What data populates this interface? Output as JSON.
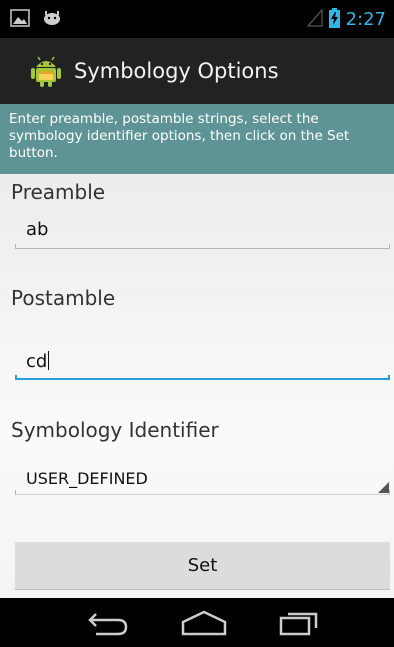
{
  "status_bar": {
    "time": "2:27",
    "icons": [
      "image-notification-icon",
      "android-debug-icon",
      "signal-icon",
      "battery-icon"
    ]
  },
  "action_bar": {
    "title": "Symbology Options",
    "icon": "android-app-icon"
  },
  "banner": {
    "text": "Enter preamble, postamble strings, select the symbology identifier options, then click on the Set button."
  },
  "form": {
    "preamble_label": "Preamble",
    "preamble_value": "ab",
    "postamble_label": "Postamble",
    "postamble_value": "cd",
    "symbology_label": "Symbology Identifier",
    "symbology_selected": "USER_DEFINED",
    "set_label": "Set"
  },
  "nav_bar": {
    "icons": [
      "back-icon",
      "home-icon",
      "recent-apps-icon"
    ]
  },
  "colors": {
    "accent": "#33b5e5",
    "banner": "#5e9495",
    "focus_underline": "#2a9fd6",
    "action_bar": "#222222"
  }
}
